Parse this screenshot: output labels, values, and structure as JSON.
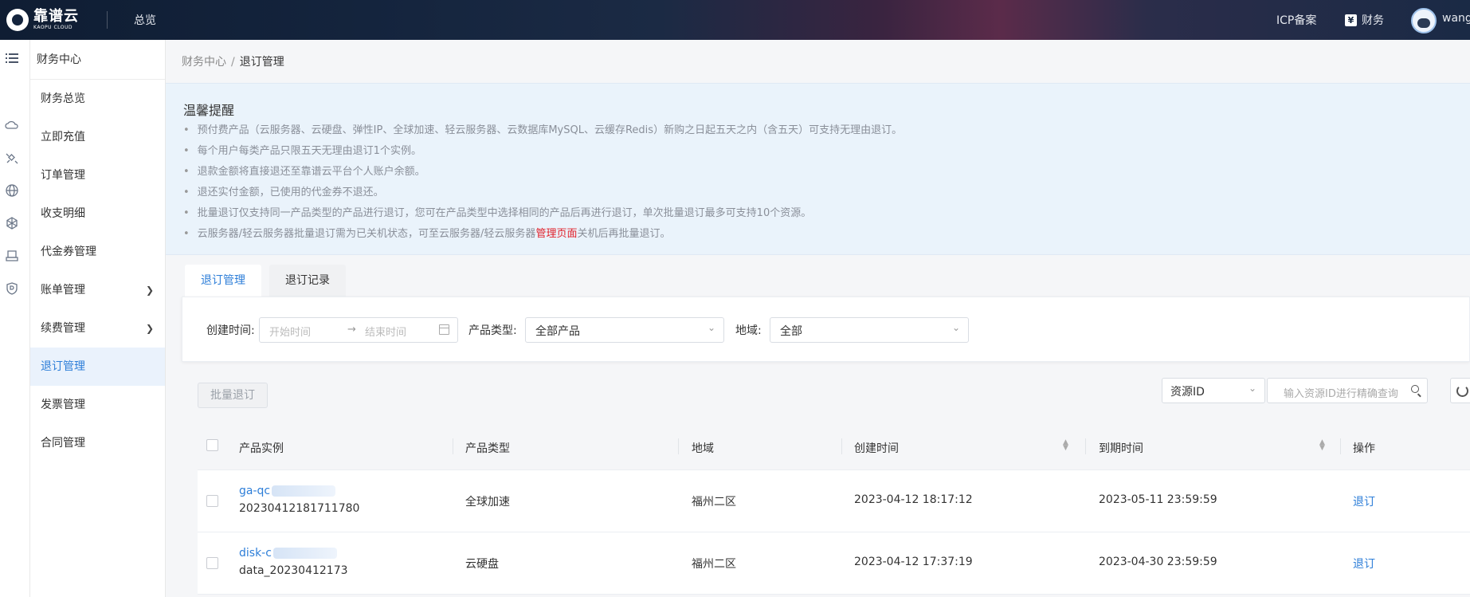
{
  "topbar": {
    "logo_cn": "靠谱云",
    "logo_en": "KAOPU CLOUD",
    "overview": "总览",
    "icp": "ICP备案",
    "finance": "财务",
    "finance_icon_glyph": "¥",
    "user": "wang"
  },
  "rail": {
    "icons": [
      "menu-list-icon",
      "cloud-icon",
      "satellite-icon",
      "globe-icon",
      "cube-network-icon",
      "server-box-icon",
      "shield-icon"
    ]
  },
  "menu": {
    "title": "财务中心",
    "items": [
      {
        "label": "财务总览"
      },
      {
        "label": "立即充值"
      },
      {
        "label": "订单管理"
      },
      {
        "label": "收支明细"
      },
      {
        "label": "代金券管理"
      },
      {
        "label": "账单管理",
        "expandable": true
      },
      {
        "label": "续费管理",
        "expandable": true
      },
      {
        "label": "退订管理",
        "active": true
      },
      {
        "label": "发票管理"
      },
      {
        "label": "合同管理"
      }
    ]
  },
  "breadcrumb": {
    "parent": "财务中心",
    "separator": "/",
    "current": "退订管理"
  },
  "notice": {
    "title": "温馨提醒",
    "items": [
      "预付费产品（云服务器、云硬盘、弹性IP、全球加速、轻云服务器、云数据库MySQL、云缓存Redis）新购之日起五天之内（含五天）可支持无理由退订。",
      "每个用户每类产品只限五天无理由退订1个实例。",
      "退款金额将直接退还至靠谱云平台个人账户余额。",
      "退还实付金额，已使用的代金券不退还。",
      "批量退订仅支持同一产品类型的产品进行退订，您可在产品类型中选择相同的产品后再进行退订，单次批量退订最多可支持10个资源。"
    ],
    "last_item": {
      "before": "云服务器/轻云服务器批量退订需为已关机状态，可至云服务器/轻云服务器",
      "highlight": "管理页面",
      "after": "关机后再批量退订。"
    },
    "highlight_color": "#e0202a"
  },
  "tabs": [
    {
      "label": "退订管理",
      "active": true
    },
    {
      "label": "退订记录"
    }
  ],
  "filters": {
    "created_label": "创建时间:",
    "start_placeholder": "开始时间",
    "range_arrow": "→",
    "end_placeholder": "结束时间",
    "product_type_label": "产品类型:",
    "product_type_value": "全部产品",
    "region_label": "地域:",
    "region_value": "全部"
  },
  "toolbar": {
    "batch_button": "批量退订",
    "search_field_value": "资源ID",
    "search_placeholder": "输入资源ID进行精确查询"
  },
  "table": {
    "columns": [
      "产品实例",
      "产品类型",
      "地域",
      "创建时间",
      "到期时间",
      "操作"
    ],
    "rows": [
      {
        "instance_id": "ga-qc",
        "instance_name": "20230412181711780",
        "product_type": "全球加速",
        "region": "福州二区",
        "created": "2023-04-12 18:17:12",
        "expires": "2023-05-11 23:59:59",
        "action": "退订"
      },
      {
        "instance_id": "disk-c",
        "instance_name": "data_20230412173",
        "product_type": "云硬盘",
        "region": "福州二区",
        "created": "2023-04-12 17:37:19",
        "expires": "2023-04-30 23:59:59",
        "action": "退订"
      }
    ]
  },
  "colors": {
    "accent": "#2d7ed8",
    "notice_bg": "#eaf3fb",
    "active_menu_bg": "#eaf2fc"
  }
}
